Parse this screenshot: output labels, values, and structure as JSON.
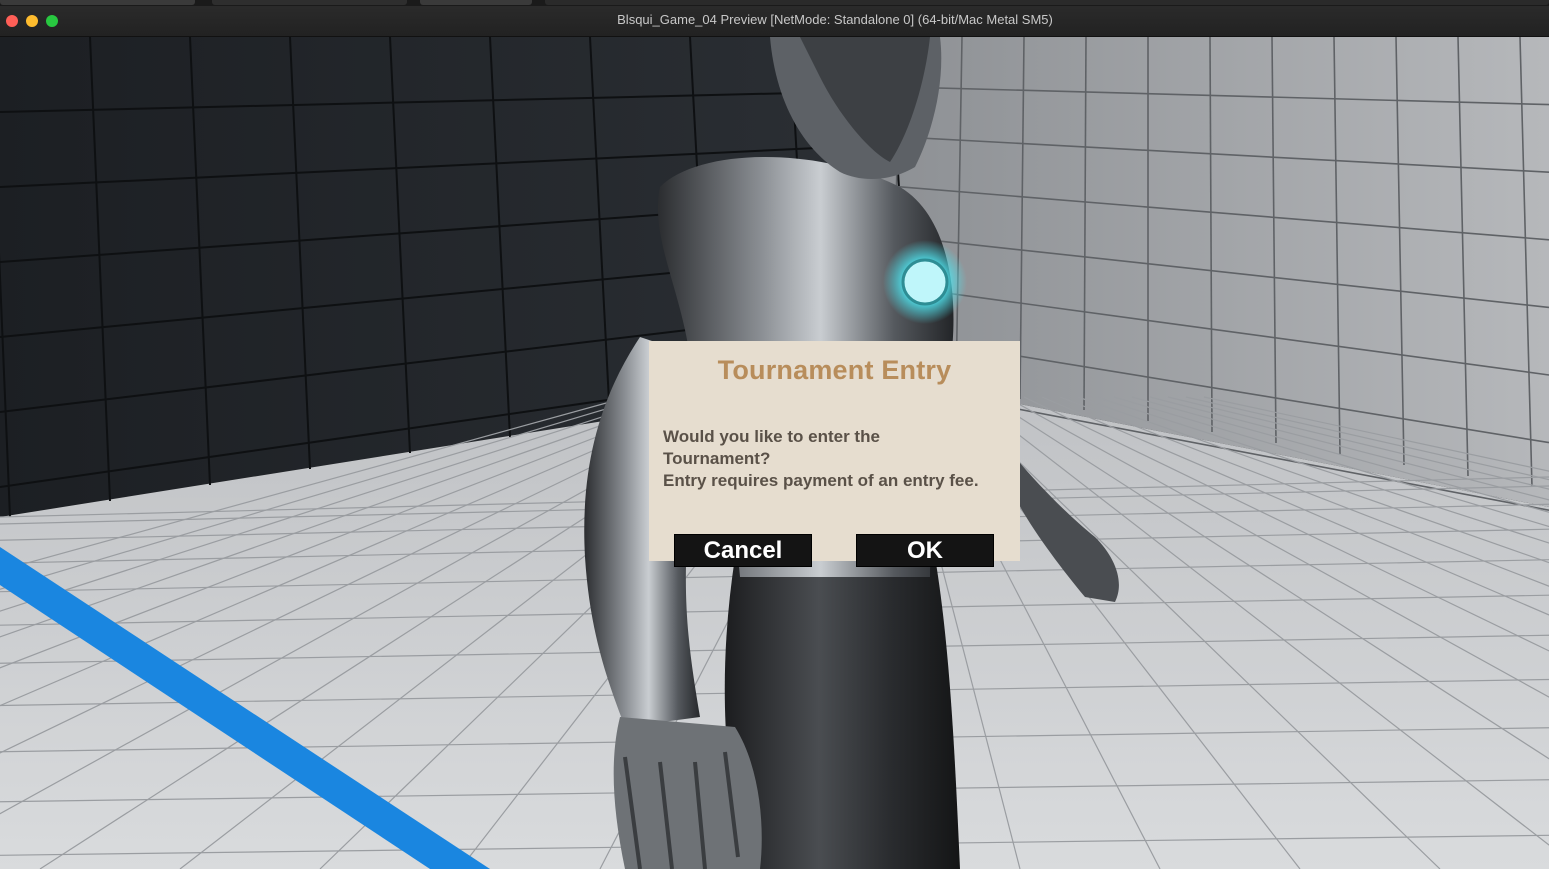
{
  "window": {
    "title": "Blsqui_Game_04 Preview [NetMode: Standalone 0]  (64-bit/Mac Metal SM5)",
    "controls": {
      "close_color": "#ff5f57",
      "minimize_color": "#febc2e",
      "maximize_color": "#28c840"
    }
  },
  "scene": {
    "accent_line_color": "#1a86e0",
    "chest_light_color": "#4fe3ee"
  },
  "dialog": {
    "title": "Tournament Entry",
    "message_lines": [
      "Would you like to enter the",
      "Tournament?",
      "Entry requires payment of an entry fee."
    ],
    "cancel_label": "Cancel",
    "ok_label": "OK"
  }
}
